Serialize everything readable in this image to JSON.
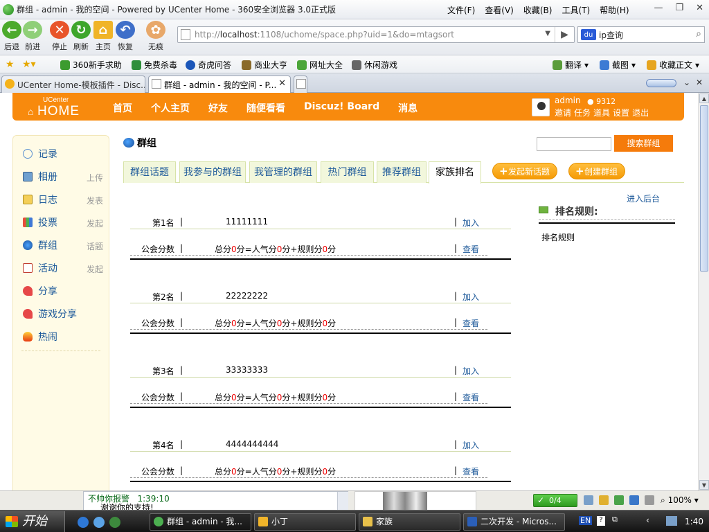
{
  "browser": {
    "window_title": "群组 - admin - 我的空间 - Powered by UCenter Home - 360安全浏览器 3.0正式版",
    "menu": [
      "文件(F)",
      "查看(V)",
      "收藏(B)",
      "工具(T)",
      "帮助(H)"
    ],
    "nav": {
      "back": "后退",
      "forward": "前进",
      "stop": "停止",
      "refresh": "刷新",
      "home": "主页",
      "restore": "恢复",
      "incognito": "无痕"
    },
    "url_prefix": "http://",
    "url_host": "localhost",
    "url_rest": ":1108/uchome/space.php?uid=1&do=mtagsort",
    "search_text": "ip查询",
    "favorites": [
      "360新手求助",
      "免费杀毒",
      "奇虎问答",
      "商业大亨",
      "网址大全",
      "休闲游戏"
    ],
    "fav_right": [
      "翻译",
      "截图",
      "收藏正文"
    ],
    "tabs": [
      {
        "label": "UCenter Home-模板插件 - Disc..."
      },
      {
        "label": "群组 - admin - 我的空间 - P..."
      }
    ]
  },
  "site": {
    "logo_small": "UCenter",
    "logo_big": "HOME",
    "nav": [
      "首页",
      "个人主页",
      "好友",
      "随便看看",
      "Discuz! Board",
      "消息"
    ],
    "user": {
      "name": "admin",
      "points": "9312",
      "links": [
        "邀请",
        "任务",
        "道具",
        "设置",
        "退出"
      ]
    }
  },
  "sidebar": {
    "items": [
      {
        "label": "记录",
        "sub": ""
      },
      {
        "label": "相册",
        "sub": "上传"
      },
      {
        "label": "日志",
        "sub": "发表"
      },
      {
        "label": "投票",
        "sub": "发起"
      },
      {
        "label": "群组",
        "sub": "话题"
      },
      {
        "label": "活动",
        "sub": "发起"
      },
      {
        "label": "分享",
        "sub": ""
      },
      {
        "label": "游戏分享",
        "sub": ""
      },
      {
        "label": "热闹",
        "sub": ""
      }
    ]
  },
  "main": {
    "title": "群组",
    "search_button": "搜索群组",
    "tabs": [
      "群组话题",
      "我参与的群组",
      "我管理的群组",
      "热门群组",
      "推荐群组",
      "家族排名"
    ],
    "action_buttons": [
      "发起新话题",
      "创建群组"
    ],
    "score_label": "公会分数",
    "score_parts": {
      "total": "总分",
      "value": "0",
      "unit": "分",
      "equals": "=人气分",
      "plus": "+规则分"
    },
    "join_label": "加入",
    "view_label": "查看",
    "rankings": [
      {
        "rank": "第1名",
        "name": "11111111"
      },
      {
        "rank": "第2名",
        "name": "22222222"
      },
      {
        "rank": "第3名",
        "name": "33333333"
      },
      {
        "rank": "第4名",
        "name": "4444444444"
      }
    ],
    "enter_admin": "进入后台",
    "rules_title": "排名规则:",
    "rules_body": "排名规则"
  },
  "statusbar": {
    "chat_sender": "不帅你报警",
    "chat_time": "1:39:10",
    "chat_message": "谢谢你的支持!",
    "security": "0/4",
    "zoom": "100%"
  },
  "taskbar": {
    "start": "开始",
    "tasks": [
      "群组 - admin - 我...",
      "小丁",
      "家族",
      "二次开发 - Micros..."
    ],
    "lang": "EN",
    "clock": "1:40"
  },
  "colors": {
    "orange": "#f88a0d",
    "link_blue": "#1e5a9a",
    "red": "#e00000",
    "tab_green_bg": "#f2f7dc"
  }
}
